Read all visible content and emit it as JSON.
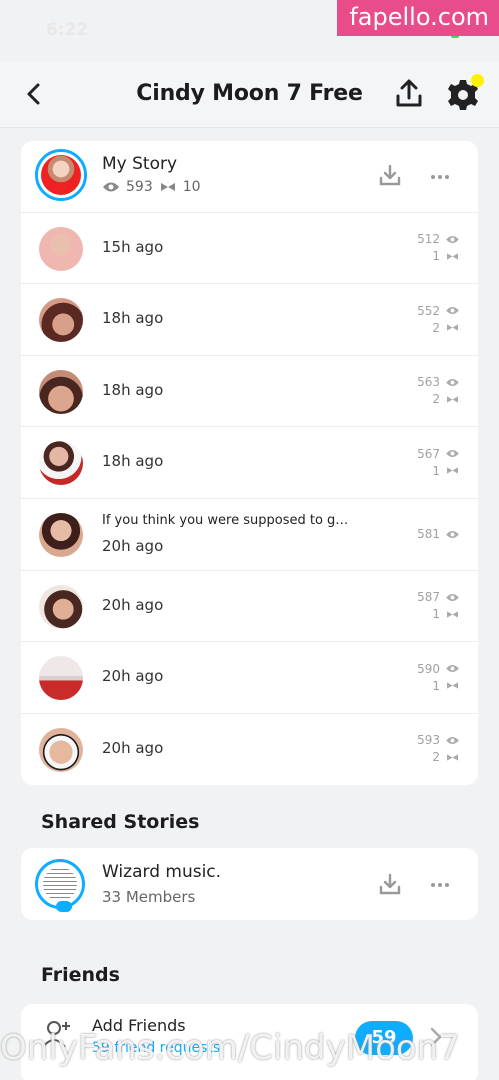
{
  "status": {
    "time": "6:22"
  },
  "watermark": {
    "top": "fapello.com",
    "bottom": "OnlyFans.com/CindyMoon7"
  },
  "header": {
    "title": "Cindy Moon 7 Free"
  },
  "my_story": {
    "title": "My Story",
    "views": "593",
    "screenshots": "10"
  },
  "story_items": [
    {
      "time": "15h ago",
      "views": "512",
      "screenshots": "1"
    },
    {
      "time": "18h ago",
      "views": "552",
      "screenshots": "2"
    },
    {
      "time": "18h ago",
      "views": "563",
      "screenshots": "2"
    },
    {
      "time": "18h ago",
      "views": "567",
      "screenshots": "1"
    },
    {
      "caption": "If you think you were supposed to g…",
      "time": "20h ago",
      "views": "581"
    },
    {
      "time": "20h ago",
      "views": "587",
      "screenshots": "1"
    },
    {
      "time": "20h ago",
      "views": "590",
      "screenshots": "1"
    },
    {
      "time": "20h ago",
      "views": "593",
      "screenshots": "2"
    }
  ],
  "shared_stories": {
    "heading": "Shared Stories",
    "item": {
      "title": "Wizard music.",
      "members": "33 Members"
    }
  },
  "friends": {
    "heading": "Friends",
    "add_friends": {
      "title": "Add Friends",
      "subtitle": "59 friend requests",
      "badge": "59"
    }
  },
  "colors": {
    "accent": "#0eadff",
    "notification": "#fff200",
    "watermark_badge": "#e84c8a"
  }
}
